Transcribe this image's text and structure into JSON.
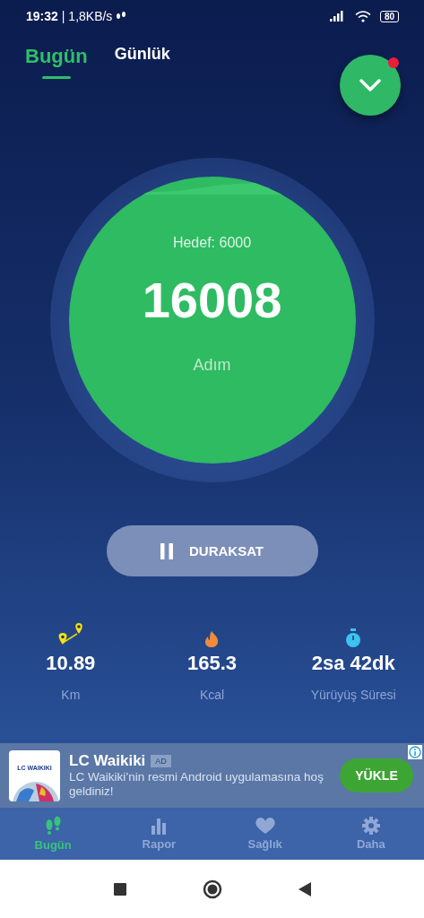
{
  "status_bar": {
    "time": "19:32",
    "speed": "| 1,8KB/s",
    "battery": "80"
  },
  "tabs": [
    {
      "label": "Bugün",
      "selected": true
    },
    {
      "label": "Günlük",
      "selected": false
    }
  ],
  "notification": {
    "unread": true
  },
  "goal": {
    "target": "Hedef: 6000",
    "steps": "16008",
    "unit": "Adım"
  },
  "pause_button": {
    "label": "DURAKSAT"
  },
  "stats": [
    {
      "kind": "distance",
      "value": "10.89",
      "label": "Km"
    },
    {
      "kind": "calories",
      "value": "165.3",
      "label": "Kcal"
    },
    {
      "kind": "time",
      "value": "2sa 42dk",
      "label": "Yürüyüş Süresi"
    }
  ],
  "ad": {
    "logo_text": "LC WAIKIKI",
    "title": "LC Waikiki",
    "badge": "AD",
    "text": "LC Waikiki’nin resmi Android uygulamasına hoş geldiniz!",
    "button": "YÜKLE"
  },
  "bottom_nav": [
    {
      "kind": "steps",
      "label": "Bugün",
      "selected": true
    },
    {
      "kind": "report",
      "label": "Rapor",
      "selected": false
    },
    {
      "kind": "health",
      "label": "Sağlık",
      "selected": false
    },
    {
      "kind": "more",
      "label": "Daha",
      "selected": false
    }
  ]
}
